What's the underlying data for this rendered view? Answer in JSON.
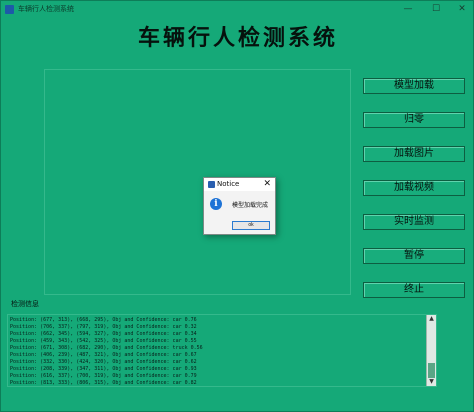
{
  "window": {
    "title": "车辆行人检测系统",
    "minimize": "—",
    "maximize": "☐",
    "close": "✕"
  },
  "heading": "车辆行人检测系统",
  "buttons": {
    "load_model": "模型加载",
    "reset": "归零",
    "load_image": "加载图片",
    "load_video": "加载视频",
    "realtime": "实时监测",
    "pause": "暂停",
    "stop": "终止"
  },
  "log": {
    "label": "检测信息",
    "lines": [
      "Position: (677, 313), (668, 295), Obj and Confidence: car 0.76",
      "Position: (706, 337), (797, 319), Obj and Confidence: car 0.32",
      "Position: (662, 345), (594, 327), Obj and Confidence: car 0.34",
      "Position: (459, 343), (542, 325), Obj and Confidence: car 0.55",
      "Position: (671, 308), (682, 290), Obj and Confidence: truck 0.56",
      "Position: (406, 239), (487, 321), Obj and Confidence: car 0.67",
      "Position: (332, 330), (424, 320), Obj and Confidence: car 0.62",
      "Position: (208, 339), (347, 311), Obj and Confidence: car 0.93",
      "Position: (616, 337), (700, 319), Obj and Confidence: car 0.79",
      "Position: (813, 333), (806, 315), Obj and Confidence: car 0.82"
    ]
  },
  "dialog": {
    "title": "Notice",
    "message": "模型加载完成",
    "ok": "ok",
    "close": "✕",
    "info_glyph": "i"
  },
  "scroll": {
    "up": "▲",
    "down": "▼"
  },
  "colors": {
    "background": "#15a978",
    "info_icon": "#1e73d6"
  }
}
